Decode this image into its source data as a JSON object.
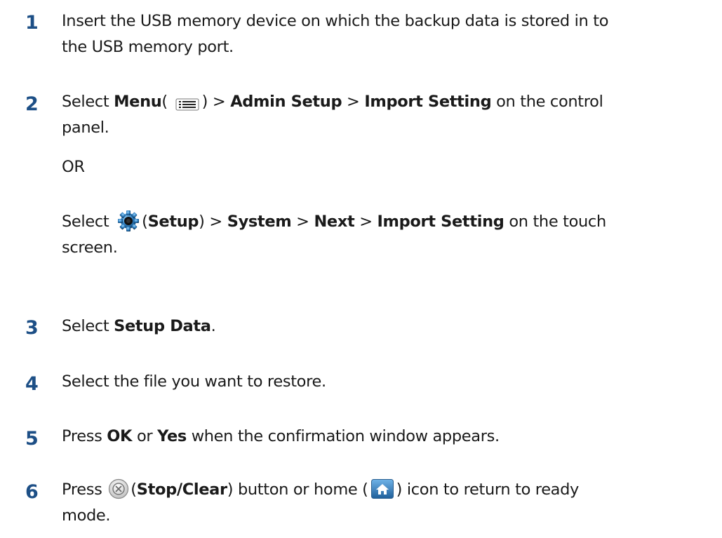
{
  "steps": [
    {
      "num": "1",
      "line1": "Insert the USB memory device on which the backup data is stored in to",
      "line2": "the USB memory port."
    },
    {
      "num": "2",
      "a_pre": "Select ",
      "a_menu": "Menu",
      "a_open": "( ",
      "a_close": ") > ",
      "a_admin": "Admin Setup",
      "a_sep": " > ",
      "a_import": "Import Setting",
      "a_post": " on the control",
      "a_line2": "panel.",
      "or": "OR",
      "b_pre": "Select ",
      "b_open": "(",
      "b_setup": "Setup",
      "b_close": ") > ",
      "b_system": "System",
      "b_sep1": " > ",
      "b_next": "Next",
      "b_sep2": " > ",
      "b_import": "Import Setting",
      "b_post": " on the touch",
      "b_line2": "screen."
    },
    {
      "num": "3",
      "pre": "Select ",
      "bold": "Setup Data",
      "post": "."
    },
    {
      "num": "4",
      "text": "Select the file you want to restore."
    },
    {
      "num": "5",
      "pre": "Press ",
      "ok": "OK",
      "mid": " or ",
      "yes": "Yes",
      "post": " when the confirmation window appears."
    },
    {
      "num": "6",
      "pre": "Press ",
      "open": "(",
      "stop": "Stop/Clear",
      "mid": ") button or home (",
      "post": ") icon to return to ready",
      "line2": "mode."
    }
  ],
  "icons": {
    "menu": "menu-icon",
    "setup": "gear-icon",
    "stop": "stop-clear-icon",
    "home": "home-icon"
  },
  "colors": {
    "step_number": "#1d4f86",
    "text": "#1a1a1a"
  }
}
